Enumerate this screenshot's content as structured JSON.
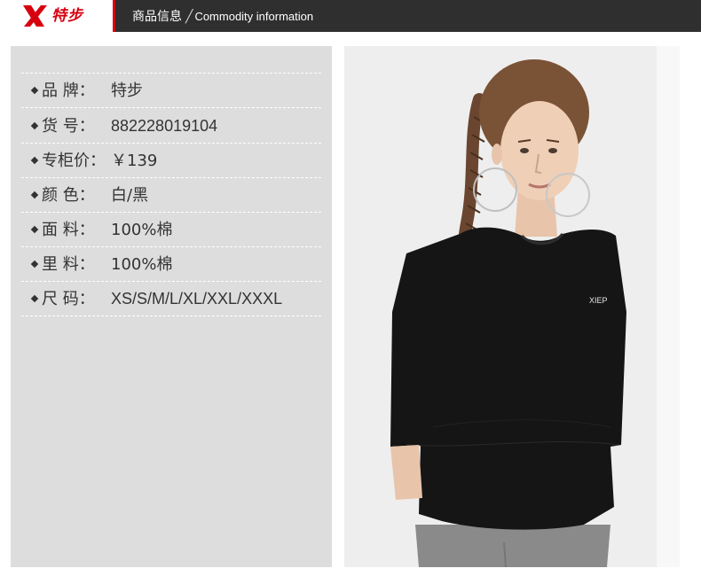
{
  "header": {
    "brand_name": "特步",
    "brand_color": "#d7000f",
    "title_cn": "商品信息",
    "title_sep": "╱",
    "title_en": "Commodity information",
    "logo_icon": "xtep-x-logo-icon"
  },
  "specs": [
    {
      "label": "品 牌：",
      "value": "特步"
    },
    {
      "label": "货 号：",
      "value": "882228019104"
    },
    {
      "label": "专柜价：",
      "value": "￥139"
    },
    {
      "label": "颜 色：",
      "value": "白/黑"
    },
    {
      "label": "面 料：",
      "value": "100%棉"
    },
    {
      "label": "里 料：",
      "value": "100%棉"
    },
    {
      "label": "尺 码：",
      "value": "XS/S/M/L/XL/XXL/XXXL"
    }
  ],
  "photo": {
    "shirt_print": "XIEP"
  },
  "colors": {
    "header_bg": "#2f2f2f",
    "panel_bg": "#dddddd",
    "shirt": "#151515",
    "leggings": "#8a8a8a"
  }
}
